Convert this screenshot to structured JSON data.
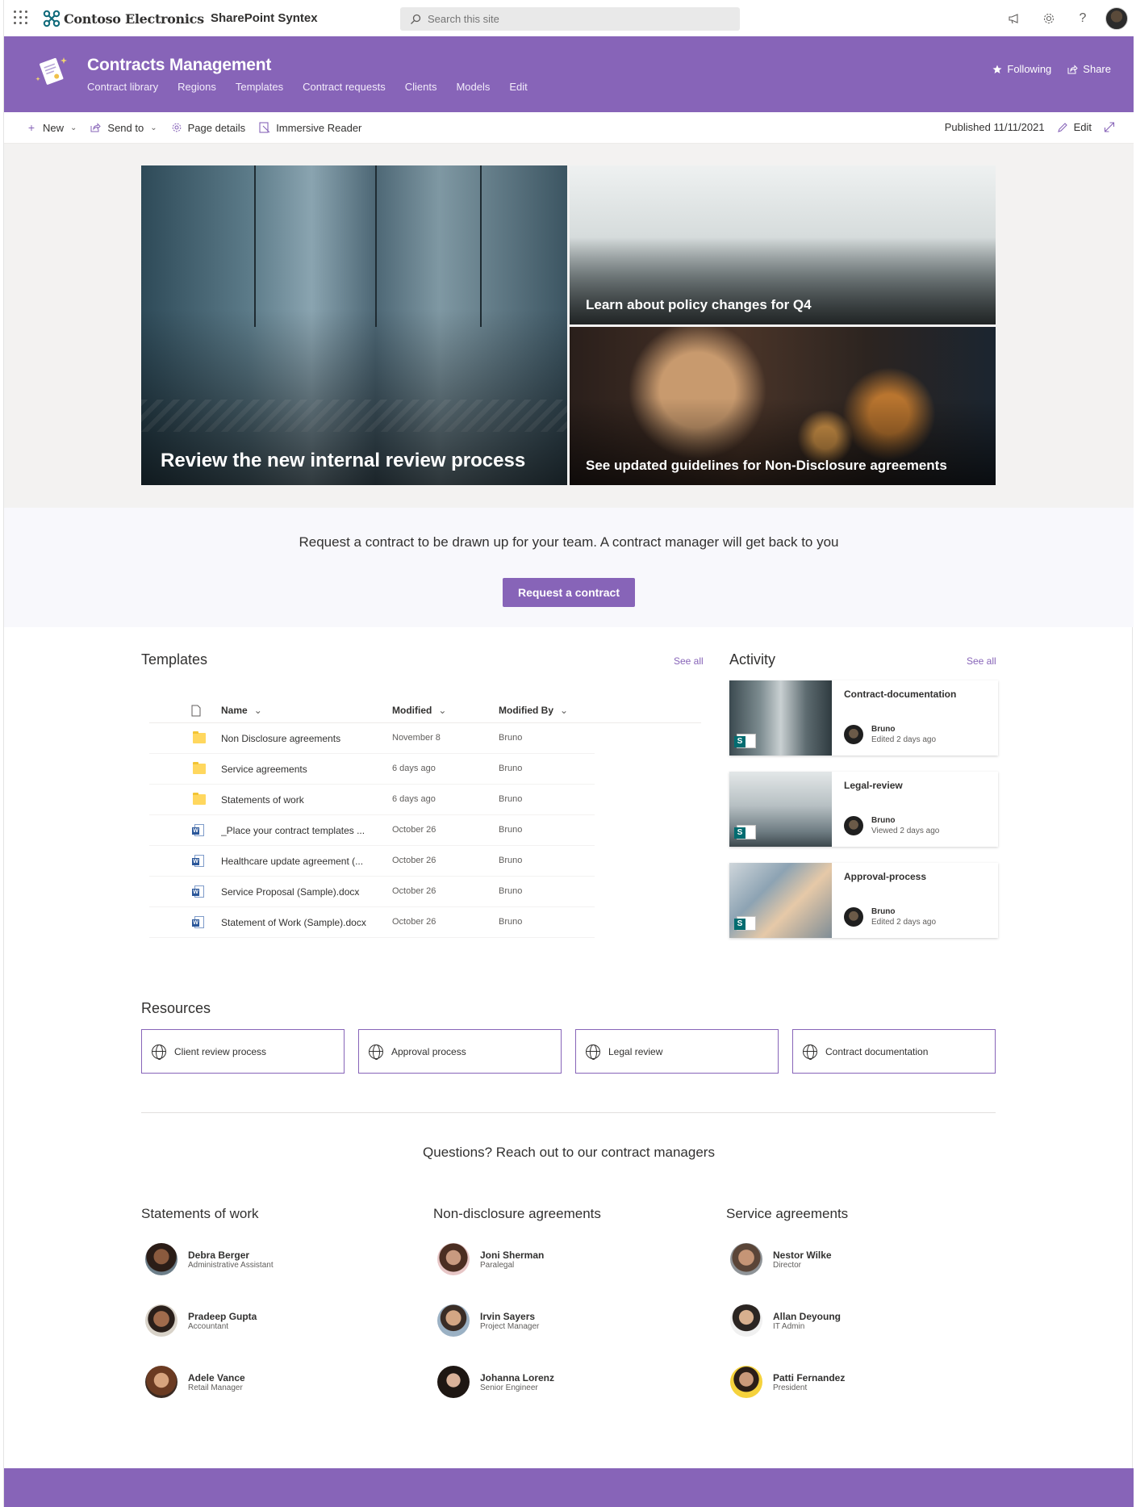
{
  "suitebar": {
    "brand": "Contoso Electronics",
    "app": "SharePoint Syntex",
    "search_placeholder": "Search this site"
  },
  "site": {
    "title": "Contracts Management",
    "nav": [
      "Contract library",
      "Regions",
      "Templates",
      "Contract requests",
      "Clients",
      "Models",
      "Edit"
    ],
    "following": "Following",
    "share": "Share"
  },
  "commandbar": {
    "new": "New",
    "send_to": "Send to",
    "page_details": "Page details",
    "immersive_reader": "Immersive Reader",
    "published": "Published 11/11/2021",
    "edit": "Edit"
  },
  "hero": {
    "main": "Review the new internal review process",
    "top_right": "Learn about policy changes for Q4",
    "bottom_right": "See updated guidelines for Non-Disclosure agreements"
  },
  "cta": {
    "text": "Request a contract to be drawn up for your team. A contract manager will get back to you",
    "button": "Request a contract"
  },
  "templates": {
    "title": "Templates",
    "see_all": "See all",
    "columns": {
      "name": "Name",
      "modified": "Modified",
      "modified_by": "Modified By"
    },
    "rows": [
      {
        "type": "folder",
        "name": "Non Disclosure agreements",
        "modified": "November 8",
        "by": "Bruno"
      },
      {
        "type": "folder",
        "name": "Service agreements",
        "modified": "6 days ago",
        "by": "Bruno"
      },
      {
        "type": "folder",
        "name": "Statements of work",
        "modified": "6 days ago",
        "by": "Bruno"
      },
      {
        "type": "word",
        "name": "_Place your contract templates ...",
        "modified": "October 26",
        "by": "Bruno"
      },
      {
        "type": "word",
        "name": "Healthcare update agreement (...",
        "modified": "October 26",
        "by": "Bruno"
      },
      {
        "type": "word",
        "name": "Service Proposal (Sample).docx",
        "modified": "October 26",
        "by": "Bruno"
      },
      {
        "type": "word",
        "name": "Statement of Work (Sample).docx",
        "modified": "October 26",
        "by": "Bruno"
      }
    ]
  },
  "activity": {
    "title": "Activity",
    "see_all": "See all",
    "cards": [
      {
        "title": "Contract-documentation",
        "user": "Bruno",
        "action": "Edited 2 days ago"
      },
      {
        "title": "Legal-review",
        "user": "Bruno",
        "action": "Viewed 2 days ago"
      },
      {
        "title": "Approval-process",
        "user": "Bruno",
        "action": "Edited 2 days ago"
      }
    ]
  },
  "resources": {
    "title": "Resources",
    "links": [
      "Client review process",
      "Approval process",
      "Legal review",
      "Contract documentation"
    ]
  },
  "contacts": {
    "heading": "Questions? Reach out to our contract managers",
    "groups": [
      {
        "title": "Statements of work",
        "people": [
          {
            "name": "Debra Berger",
            "role": "Administrative Assistant"
          },
          {
            "name": "Pradeep Gupta",
            "role": "Accountant"
          },
          {
            "name": "Adele Vance",
            "role": "Retail Manager"
          }
        ]
      },
      {
        "title": "Non-disclosure agreements",
        "people": [
          {
            "name": "Joni Sherman",
            "role": "Paralegal"
          },
          {
            "name": "Irvin Sayers",
            "role": "Project Manager"
          },
          {
            "name": "Johanna Lorenz",
            "role": "Senior Engineer"
          }
        ]
      },
      {
        "title": "Service agreements",
        "people": [
          {
            "name": "Nestor Wilke",
            "role": "Director"
          },
          {
            "name": "Allan Deyoung",
            "role": "IT Admin"
          },
          {
            "name": "Patti Fernandez",
            "role": "President"
          }
        ]
      }
    ]
  },
  "colors": {
    "accent": "#8764b8",
    "hero_bg": "#f3f2f1",
    "cta_bg": "#f8f8fc"
  }
}
